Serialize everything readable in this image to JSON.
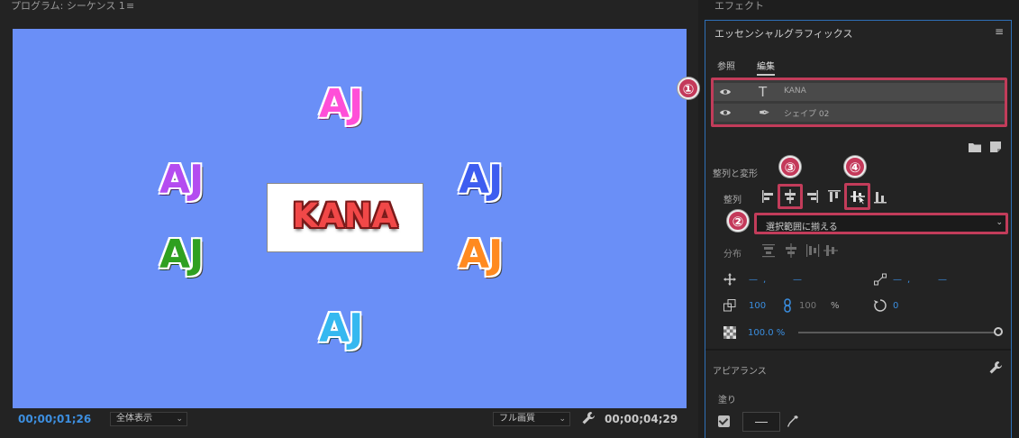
{
  "program": {
    "title": "プログラム: シーケンス 1",
    "menu_glyph": "≡",
    "timecode_current": "00;00;01;26",
    "fit_select": "全体表示",
    "quality_select": "フル画質",
    "timecode_duration": "00;00;04;29",
    "canvas": {
      "bg_color": "#6a8ff7",
      "aj_text": "AJ",
      "kana_text": "KANA"
    }
  },
  "effects_header": "エフェクト",
  "eg": {
    "title": "エッセンシャルグラフィックス",
    "menu_glyph": "≡",
    "tabs": {
      "browse": "参照",
      "edit": "編集"
    },
    "layers": [
      {
        "type_icon": "T",
        "name": "KANA"
      },
      {
        "type_icon": "✒",
        "name": "シェイプ 02"
      }
    ],
    "align_section_title": "整列と変形",
    "align_label": "整列",
    "align_dropdown": "選択範囲に揃える",
    "distribute_label": "分布",
    "position": {
      "x": "—",
      "sep": ",",
      "y": "—"
    },
    "anchor": {
      "x": "—",
      "sep": ",",
      "y": "—"
    },
    "scale": "100",
    "scale_width": "100",
    "scale_unit": "%",
    "rotation": "0",
    "opacity": "100.0 %",
    "appearance_title": "アピアランス",
    "fill_label": "塗り",
    "fill_enabled": true
  },
  "annotations": {
    "badge_1": "①",
    "badge_2": "②",
    "badge_3": "③",
    "badge_4": "④",
    "highlight_color": "#c23c5a"
  }
}
